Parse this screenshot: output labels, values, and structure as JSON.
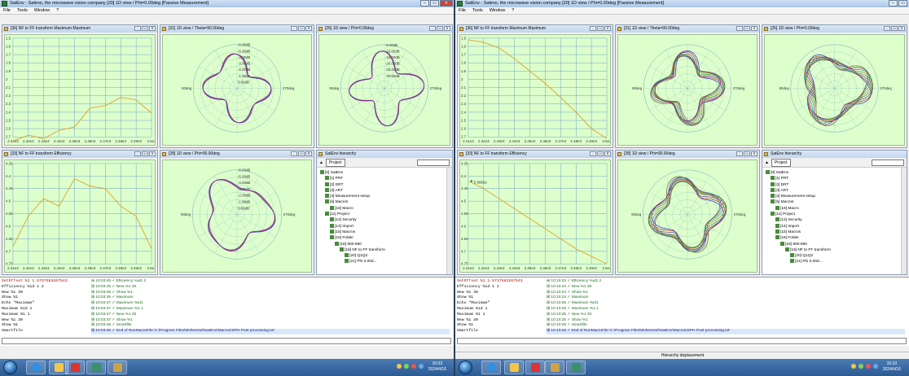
{
  "window_title": "SatEnv - Satimo, the microwave vision company [20] 1D view / Phi=0.00deg [Passive Measurement]",
  "menu": [
    "File",
    "Tools",
    "Window",
    "?"
  ],
  "window_buttons": {
    "minimize": "‒",
    "maximize": "▭",
    "close": "✕"
  },
  "panels": {
    "max": "[36] NF to FF transform Maximum Maximum",
    "eff": "[33] NF to FF transform Efficiency",
    "theta90": "[31] 1D view / Theta=90.00deg",
    "phi0": "[26] 1D view / Phi=0.00deg",
    "phi90": "[28] 1D view / Phi=90.00deg",
    "hier": "SatEnv hierarchy"
  },
  "polar_labels": {
    "left": "90deg",
    "right": "270deg"
  },
  "polar_rings_left": [
    "-6.00dB",
    "-5.00dB",
    "-4.00dB",
    "-3.00dB",
    "-2.00dB",
    "-1.00dB",
    "0.00dB"
  ],
  "polar_rings_right": [
    "-5.00dB",
    "-10.00dB",
    "-15.00dB",
    "-20.00dB",
    "-25.00dB",
    "-30.00dB"
  ],
  "x_ticks": [
    "2.41e3",
    "2.42e3",
    "2.43e3",
    "2.44e3",
    "2.45e3",
    "2.46e3",
    "2.47e3",
    "2.48e3",
    "2.49e3",
    "2.5e3"
  ],
  "max_chart_left": {
    "y_ticks": [
      "1.5",
      "1.6",
      "1.7",
      "1.8",
      "1.9",
      "2",
      "2.1",
      "2.2",
      "2.3",
      "2.4",
      "2.5",
      "2.6",
      "2.7"
    ],
    "values": [
      2.75,
      2.68,
      2.72,
      2.62,
      2.58,
      2.35,
      2.32,
      2.22,
      2.25,
      2.41
    ]
  },
  "eff_chart_left": {
    "y_ticks": [
      "4.35",
      "4.4",
      "4.45",
      "4.5",
      "4.55",
      "4.6",
      "4.65",
      "4.7",
      "4.75"
    ],
    "values": [
      4.68,
      4.56,
      4.49,
      4.52,
      4.41,
      4.44,
      4.45,
      4.52,
      4.56,
      4.69
    ]
  },
  "eff_marker_label": "5.6892e",
  "hierarchy": {
    "project_button": "Project",
    "items": [
      {
        "level": 0,
        "label": "[0] SatEnv"
      },
      {
        "level": 1,
        "label": "[1] PRT"
      },
      {
        "level": 1,
        "label": "[2] DRT"
      },
      {
        "level": 1,
        "label": "[3] ART"
      },
      {
        "level": 1,
        "label": "[4] Measurement setup"
      },
      {
        "level": 1,
        "label": "[5] Macros"
      },
      {
        "level": 2,
        "label": "[18] Macro"
      },
      {
        "level": 1,
        "label": "[11] Project"
      },
      {
        "level": 2,
        "label": "[12] Security"
      },
      {
        "level": 2,
        "label": "[14] Import"
      },
      {
        "level": 2,
        "label": "[15] Macros"
      },
      {
        "level": 2,
        "label": "[16] Folder"
      },
      {
        "level": 3,
        "label": "[18] 800-960"
      },
      {
        "level": 4,
        "label": "[19] NF to FF transform"
      },
      {
        "level": 5,
        "label": "[20] Q1Q2"
      },
      {
        "level": 5,
        "label": "[21] Phi 0.00d..."
      }
    ]
  },
  "commands": [
    {
      "text": "SetOffset %1 1.5737563267543",
      "hl": true
    },
    {
      "text": "Efficiency %id 1 2",
      "hl": false
    },
    {
      "text": "New %1 30",
      "hl": false
    },
    {
      "text": "Show %1",
      "hl": false
    },
    {
      "text": "Echo \"Maximum\"",
      "hl": false
    },
    {
      "text": "Maximum %id 1",
      "hl": false
    },
    {
      "text": "Maximum %1 1",
      "hl": false
    },
    {
      "text": "New %1 30",
      "hl": false
    },
    {
      "text": "Show %1",
      "hl": false
    },
    {
      "text": "Smartfile",
      "hl": false
    }
  ],
  "log_left": [
    "10:03:45 ✓ Efficiency %id1 2",
    "10:03:45 ✓ New %1 30",
    "10:03:45 ✓ Show %1",
    "10:03:45 ✓ Maximum",
    "10:03:47 ✓ Maximum %id1",
    "10:03:47 ✓ Maximum %1 1",
    "10:03:47 ✓ New %1 30",
    "10:03:47 ✓ Show %1",
    "10:03:48 ✓ Smartfile",
    "10:03:48 ✓ End of RunMacroFile:'C:\\Program Files\\Mvheresel\\SatEnv\\Macros\\SPH Post processing.txt'"
  ],
  "log_right": [
    "10:10:23 ✓ Efficiency %id1 2",
    "10:10:24 ✓ New %1 30",
    "10:10:24 ✓ Show %1",
    "10:10:24 ✓ Maximum",
    "10:10:25 ✓ Maximum %id1",
    "10:10:25 ✓ Maximum %1 1",
    "10:10:25 ✓ New %1 30",
    "10:10:25 ✓ Show %1",
    "10:10:26 ✓ Smartfile",
    "10:10:26 ✓ End of RunMacroFile:'C:\\Program Files\\Mvheresel\\SatEnv\\Macros\\SPH Post processing.txt'"
  ],
  "status_right": "Hierarchy displacement",
  "clock_left": {
    "time": "10:03",
    "date": "2024/4/16"
  },
  "clock_right": {
    "time": "10:10",
    "date": "2024/4/16"
  }
}
